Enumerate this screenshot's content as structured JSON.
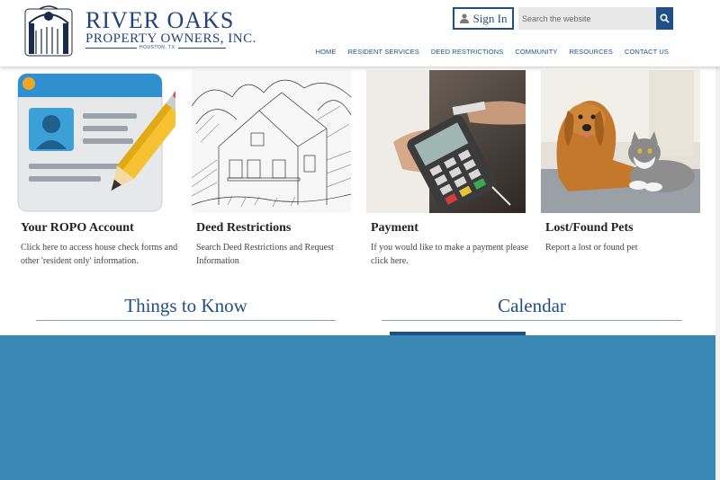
{
  "brand": {
    "title": "RIVER OAKS",
    "subtitle": "PROPERTY OWNERS, INC.",
    "city": "HOUSTON, TX"
  },
  "header": {
    "signin_label": "Sign In",
    "search_placeholder": "Search the website"
  },
  "nav": {
    "items": [
      "HOME",
      "RESIDENT SERVICES",
      "DEED RESTRICTIONS",
      "COMMUNITY",
      "RESOURCES",
      "CONTACT US"
    ]
  },
  "cards": [
    {
      "title": "Your ROPO Account",
      "desc": "Click here to access house check forms and other 'resident only' information."
    },
    {
      "title": "Deed Restrictions",
      "desc": "Search Deed Restrictions and Request Information"
    },
    {
      "title": "Payment",
      "desc": "If you would like to make a payment please click here."
    },
    {
      "title": "Lost/Found Pets",
      "desc": "Report a lost or found pet"
    }
  ],
  "sections": {
    "things_to_know": "Things to Know",
    "calendar": "Calendar"
  },
  "colors": {
    "brand_blue": "#1f4f86",
    "band_blue": "#3988b4"
  }
}
